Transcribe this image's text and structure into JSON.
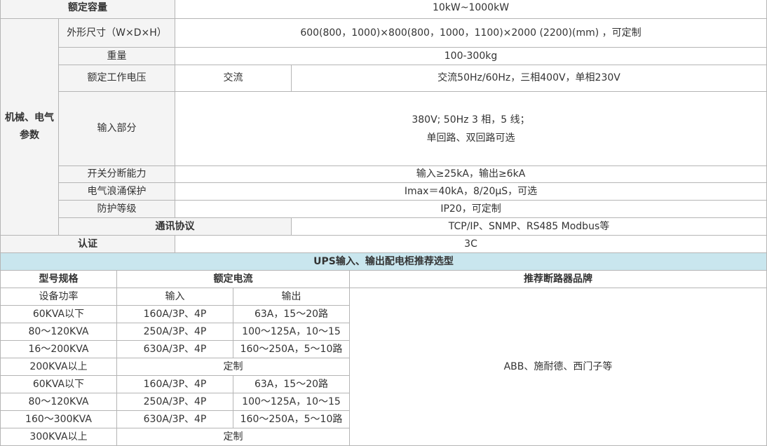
{
  "spec": {
    "rated_capacity": {
      "label": "额定容量",
      "value": "10kW~1000kW"
    },
    "group_label": "机械、电气参数",
    "dimensions": {
      "label": "外形尺寸（W×D×H）",
      "value": "600(800，1000)×800(800，1000，1100)×2000 (2200)(mm) ，可定制"
    },
    "weight": {
      "label": "重量",
      "value": "100-300kg"
    },
    "voltage": {
      "label": "额定工作电压",
      "sub": "交流",
      "value": "交流50Hz/60Hz，三相400V，单相230V"
    },
    "input": {
      "label": "输入部分",
      "line1": "380V; 50Hz 3 相，5 线；",
      "line2": "单回路、双回路可选"
    },
    "breaking": {
      "label": "开关分断能力",
      "value": "输入≥25kA，输出≥6kA"
    },
    "surge": {
      "label": "电气浪涌保护",
      "value": "Imax＝40kA，8/20μS，可选"
    },
    "protection": {
      "label": "防护等级",
      "value": "IP20，可定制"
    },
    "protocol": {
      "label": "通讯协议",
      "value": "TCP/IP、SNMP、RS485 Modbus等"
    },
    "cert": {
      "label": "认证",
      "value": "3C"
    }
  },
  "selection": {
    "banner": "UPS输入、输出配电柜推荐选型",
    "h_model": "型号规格",
    "h_current": "额定电流",
    "h_brand": "推荐断路器品牌",
    "h_power": "设备功率",
    "h_in": "输入",
    "h_out": "输出",
    "brand_value": "ABB、施耐德、西门子等",
    "rows": [
      {
        "power": "60KVA以下",
        "in": "160A/3P、4P",
        "out": "63A，15～20路"
      },
      {
        "power": "80～120KVA",
        "in": "250A/3P、4P",
        "out": "100～125A，10～15"
      },
      {
        "power": "16～200KVA",
        "in": "630A/3P、4P",
        "out": "160～250A，5～10路"
      },
      {
        "power": "200KVA以上",
        "custom": "定制"
      },
      {
        "power": "60KVA以下",
        "in": "160A/3P、4P",
        "out": "63A，15～20路"
      },
      {
        "power": "80～120KVA",
        "in": "250A/3P、4P",
        "out": "100～125A，10～15"
      },
      {
        "power": "160～300KVA",
        "in": "630A/3P、4P",
        "out": "160～250A，5～10路"
      },
      {
        "power": "300KVA以上",
        "custom": "定制"
      }
    ]
  }
}
